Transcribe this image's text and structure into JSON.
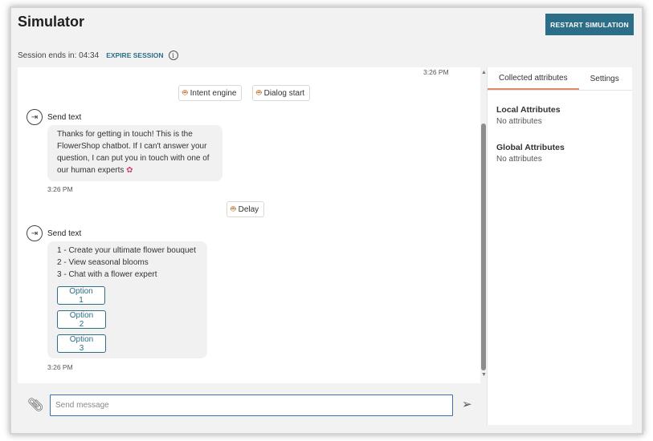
{
  "header": {
    "title": "Simulator",
    "restart_label": "RESTART SIMULATION",
    "session_label": "Session ends in: 04:34",
    "expire_label": "EXPIRE SESSION",
    "info_glyph": "i"
  },
  "chat": {
    "top_time": "3:26 PM",
    "chips_top": [
      {
        "label": "Intent engine",
        "icon": "bot-icon"
      },
      {
        "label": "Dialog start",
        "icon": "bot-icon"
      }
    ],
    "message1": {
      "sender": "Send text",
      "lines": [
        "Thanks for getting in touch! This is the",
        "FlowerShop chatbot. If I can't answer your",
        "question, I can put you in touch with one of",
        "our human experts"
      ],
      "emoji": "✿",
      "time": "3:26 PM"
    },
    "delay_chip": {
      "label": "Delay",
      "icon": "bot-icon"
    },
    "message2": {
      "sender": "Send text",
      "lines": [
        "1 - Create your ultimate flower bouquet",
        "2 - View seasonal blooms",
        "3 - Chat with a flower expert"
      ],
      "options": [
        "Option 1",
        "Option 2",
        "Option 3"
      ],
      "time": "3:26 PM"
    }
  },
  "composer": {
    "placeholder": "Send message",
    "attach_icon": "paperclip-icon",
    "send_icon": "send-icon"
  },
  "panel": {
    "tabs": [
      "Collected attributes",
      "Settings"
    ],
    "active_tab": "Collected attributes",
    "local_title": "Local Attributes",
    "local_value": "No attributes",
    "global_title": "Global Attributes",
    "global_value": "No attributes"
  },
  "colors": {
    "accent": "#2c6e88",
    "active_tab_underline": "#e08a6a",
    "bubble_bg": "#f1f1f1"
  }
}
